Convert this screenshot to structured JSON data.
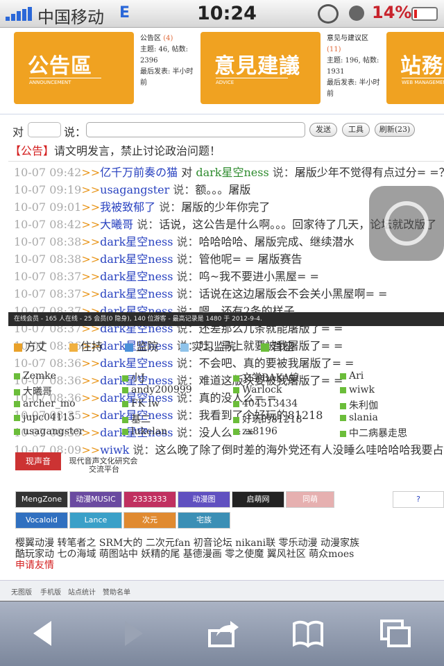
{
  "status": {
    "carrier": "中国移动",
    "network": "E",
    "time": "10:24",
    "battery": "14%",
    "battery_level": 0.14
  },
  "forums": [
    {
      "image_cn": "公告區",
      "image_en": "ANNOUNCEMENT",
      "name": "公告区",
      "count": "(4)",
      "stats": "主题: 46, 帖数: 2396",
      "last": "最后发表: 半小时前"
    },
    {
      "image_cn": "意見建議",
      "image_en": "ADVICE",
      "name": "意见与建议区",
      "count": "(11)",
      "stats": "主题: 196, 帖数: 1931",
      "last": "最后发表: 半小时前"
    },
    {
      "image_cn": "站務",
      "image_en": "WEB MANAGEMENT"
    }
  ],
  "shoutbox": {
    "to_label": "对",
    "said_label": "说：",
    "send": "发送",
    "tools": "工具",
    "refresh": "刷新(23)"
  },
  "notice": {
    "tag": "【公告】",
    "text": "请文明发言，禁止讨论政治问题！"
  },
  "messages": [
    {
      "time": "10-07 09:42",
      "arrow": ">>",
      "user": "亿千万前奏の猫",
      "mid": " 对 ",
      "target": "dark星空ness",
      "said": " 说：",
      "text": "屠版少年不觉得有点过分= =？"
    },
    {
      "time": "10-07 09:19",
      "arrow": ">>",
      "user": "usagangster",
      "said": " 说：",
      "text": "额。。。屠版"
    },
    {
      "time": "10-07 09:01",
      "arrow": ">>",
      "user": "我被致郁了",
      "said": " 说：",
      "text": "屠版的少年你完了"
    },
    {
      "time": "10-07 08:42",
      "arrow": ">>",
      "user": "大曦哥",
      "said": " 说：",
      "text": "话说，这公告是什么啊。。。回家待了几天，论坛就改版了"
    },
    {
      "time": "10-07 08:38",
      "arrow": ">>",
      "user": "dark星空ness",
      "said": " 说：",
      "text": "哈哈哈哈、屠版完成、继续潜水"
    },
    {
      "time": "10-07 08:38",
      "arrow": ">>",
      "user": "dark星空ness",
      "said": " 说：",
      "text": "管他呢= = 屠版赛告"
    },
    {
      "time": "10-07 08:37",
      "arrow": ">>",
      "user": "dark星空ness",
      "said": " 说：",
      "text": "呜~我不要进小黑屋= ="
    },
    {
      "time": "10-07 08:37",
      "arrow": ">>",
      "user": "dark星空ness",
      "said": " 说：",
      "text": "话说在这边屠版会不会关小黑屋啊= ="
    },
    {
      "time": "10-07 08:37",
      "arrow": ">>",
      "user": "dark星空ness",
      "said": " 说：",
      "text": "嗯，还有2条的样子"
    },
    {
      "time": "10-07 08:37",
      "arrow": ">>",
      "user": "dark星空ness",
      "said": " 说：",
      "text": "还差那么几条就能屠版了= ="
    },
    {
      "time": "10-07 08:36",
      "arrow": ">>",
      "user": "dark星空ness",
      "said": " 说：",
      "text": "吐、马上就要被我屠版了= ="
    },
    {
      "time": "10-07 08:36",
      "arrow": ">>",
      "user": "dark星空ness",
      "said": " 说：",
      "text": "不会吧、真的要被我屠版了= ="
    },
    {
      "time": "10-07 08:36",
      "arrow": ">>",
      "user": "dark星空ness",
      "said": " 说：",
      "text": "难道这版块要被我屠版了= ="
    },
    {
      "time": "10-07 08:36",
      "arrow": ">>",
      "user": "dark星空ness",
      "said": " 说：",
      "text": "真的没人么= ="
    },
    {
      "time": "10-07 08:35",
      "arrow": ">>",
      "user": "dark星空ness",
      "said": " 说：",
      "text": "我看到了个好玩的81218"
    },
    {
      "time": "10-07 08:35",
      "arrow": ">>",
      "user": "dark星空ness",
      "said": " 说：",
      "text": "没人么= ="
    },
    {
      "time": "10-07 08:09",
      "arrow": ">>",
      "user": "wiwk",
      "said": " 说：",
      "text": "这么晚了除了倒时差的海外党还有人没睡么哇哈哈哈我要占领"
    }
  ],
  "online": {
    "summary": "在线会员 - 165 人在线 - 25 会员(0 隐身), 140 位游客 - 最高记录是 1480 于 2012-9-4.",
    "legend": [
      {
        "label": "方丈",
        "color": "#e9a12a"
      },
      {
        "label": "住持",
        "color": "#f0b040"
      },
      {
        "label": "监院",
        "color": "#4a90d9"
      },
      {
        "label": "实习监院",
        "color": "#8fc3ea"
      },
      {
        "label": "首座",
        "color": "#6bbd3a"
      }
    ],
    "users": [
      "Zemke",
      "小J",
      "文学BAKA娘",
      "Ari",
      "大曦哥",
      "andy200999",
      "Warlock",
      "wiwk",
      "archer_mo",
      "FK lw",
      "404513434",
      "朱利伽",
      "jupc04115",
      "基二",
      "好玩的81218",
      "slania",
      "usagangster",
      "lukelan",
      "zx8196",
      "中二病暴走思"
    ]
  },
  "links": {
    "site_name": "现代音声文化研究会",
    "site_sub": "交流平台",
    "banners": [
      "MengZone",
      "动漫MUSIC",
      "2333333",
      "动漫图",
      "启萌网",
      "同萌",
      "?",
      "Vocaloid China Fans",
      "Lance",
      "次元",
      "宅族"
    ],
    "row1": "樱翼动漫  转笔者之  SRM大的  二次元fan  初音论坛  nikani联  零乐动漫  动漫家族",
    "row2": "酷玩家动  七の海域  萌图站中  妖精的尾  基德漫画  零之使魔  翼风社区  萌众moes",
    "apply": "申请友情"
  },
  "footer": {
    "items": [
      "无图版",
      "手机版",
      "站点统计",
      "赞助名单"
    ]
  }
}
